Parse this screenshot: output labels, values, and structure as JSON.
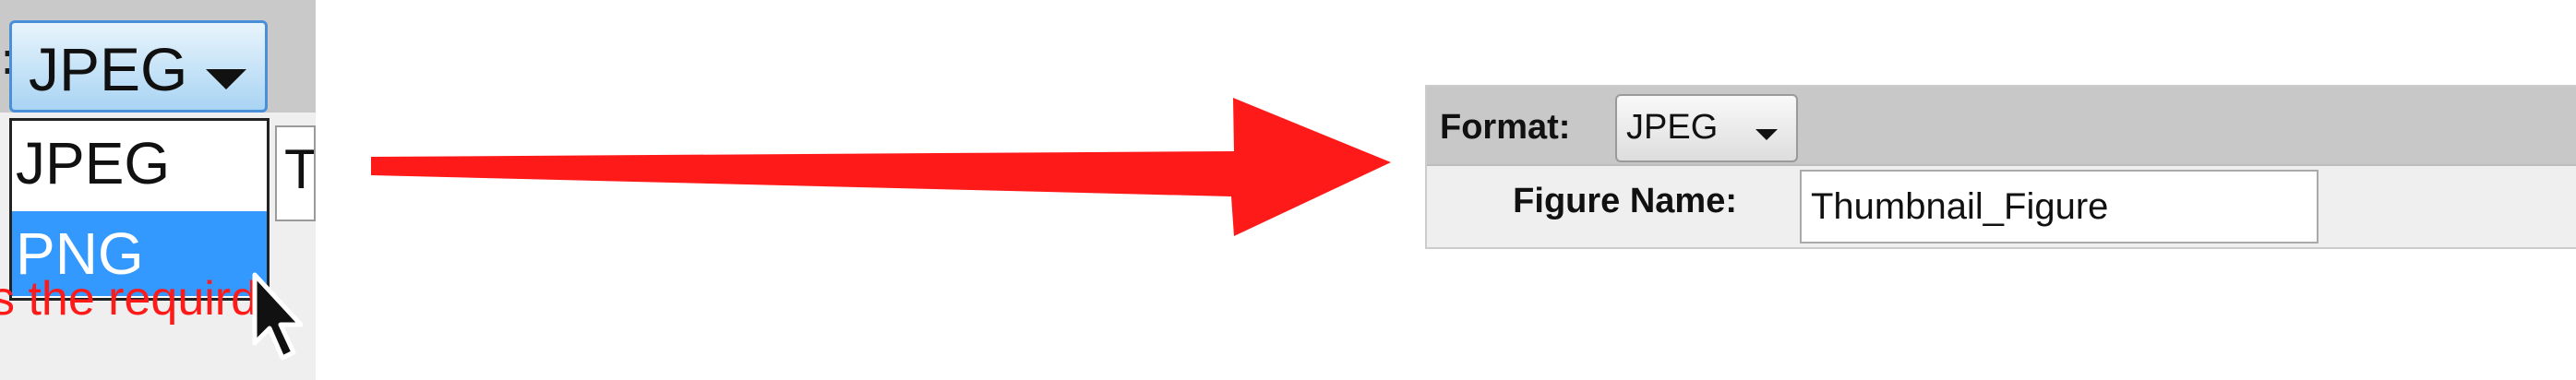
{
  "left_panel": {
    "select_value": "JPEG",
    "dropdown_options": [
      "JPEG",
      "PNG"
    ],
    "selected_option": "PNG",
    "partial_input_text": "T",
    "partial_error_text": "s the requird"
  },
  "right_panel": {
    "format_label": "Format:",
    "format_value": "JPEG",
    "figure_name_label": "Figure Name:",
    "figure_name_value": "Thumbnail_Figure"
  },
  "colors": {
    "arrow": "#ff1a1a",
    "dropdown_highlight": "#3399ff",
    "select_active_border": "#4a90d9",
    "form_bar": "#c8c8c8",
    "form_bg": "#efefef"
  },
  "icons": {
    "cursor": "mouse-pointer-icon",
    "arrow": "right-arrow-icon"
  }
}
